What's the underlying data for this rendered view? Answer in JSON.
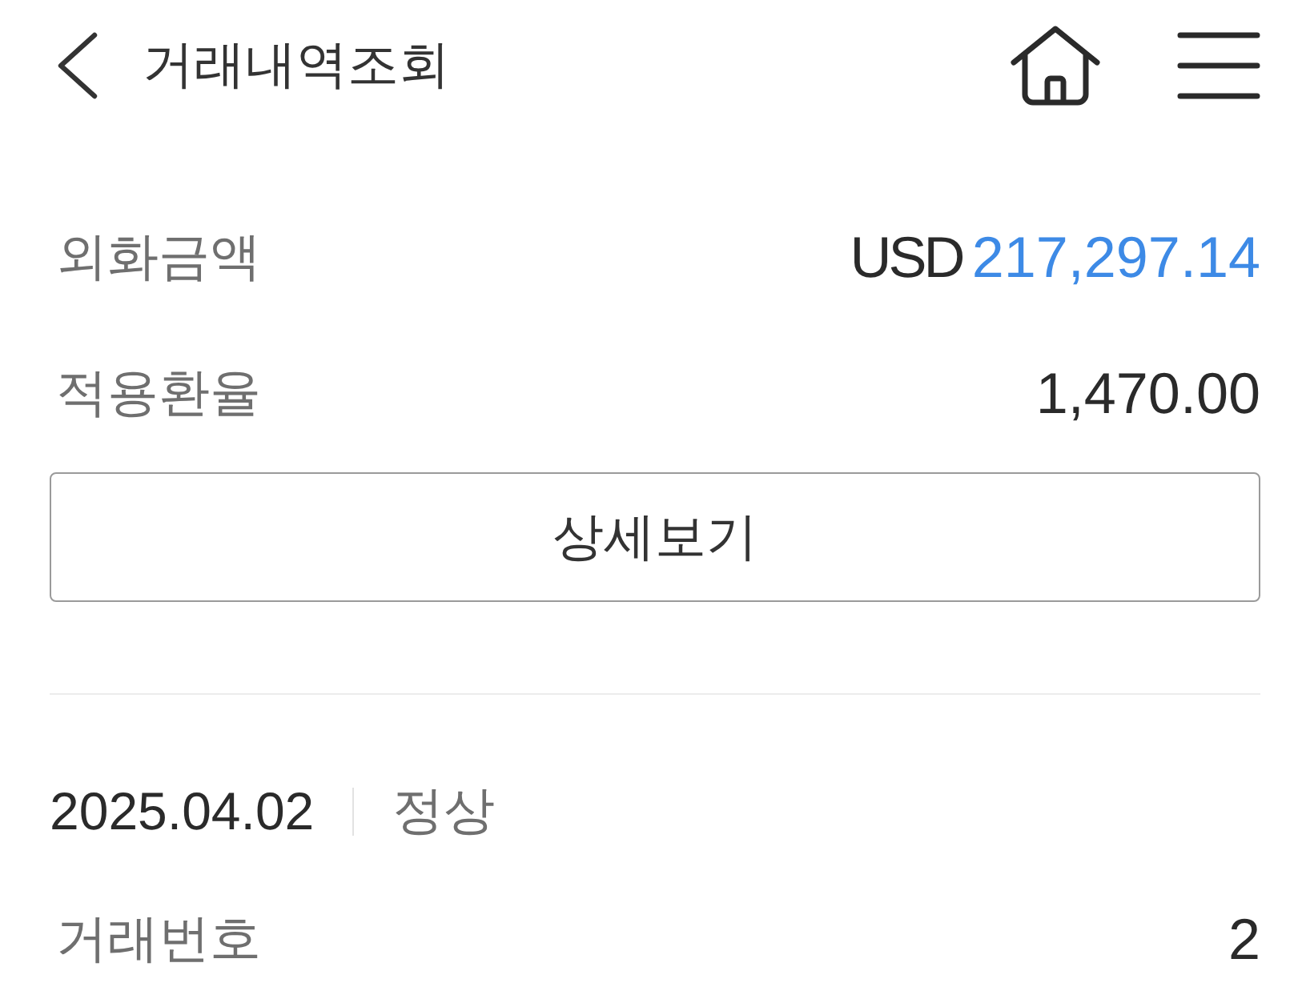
{
  "header": {
    "title": "거래내역조회"
  },
  "summary": [
    {
      "label": "외화금액",
      "currency": "USD",
      "value": "217,297.14",
      "highlight": true
    },
    {
      "label": "적용환율",
      "value": "1,470.00",
      "highlight": false
    }
  ],
  "detail_button": {
    "label": "상세보기"
  },
  "transaction": {
    "date": "2025.04.02",
    "status": "정상",
    "rows": [
      {
        "label": "거래번호",
        "value": "2"
      }
    ]
  }
}
